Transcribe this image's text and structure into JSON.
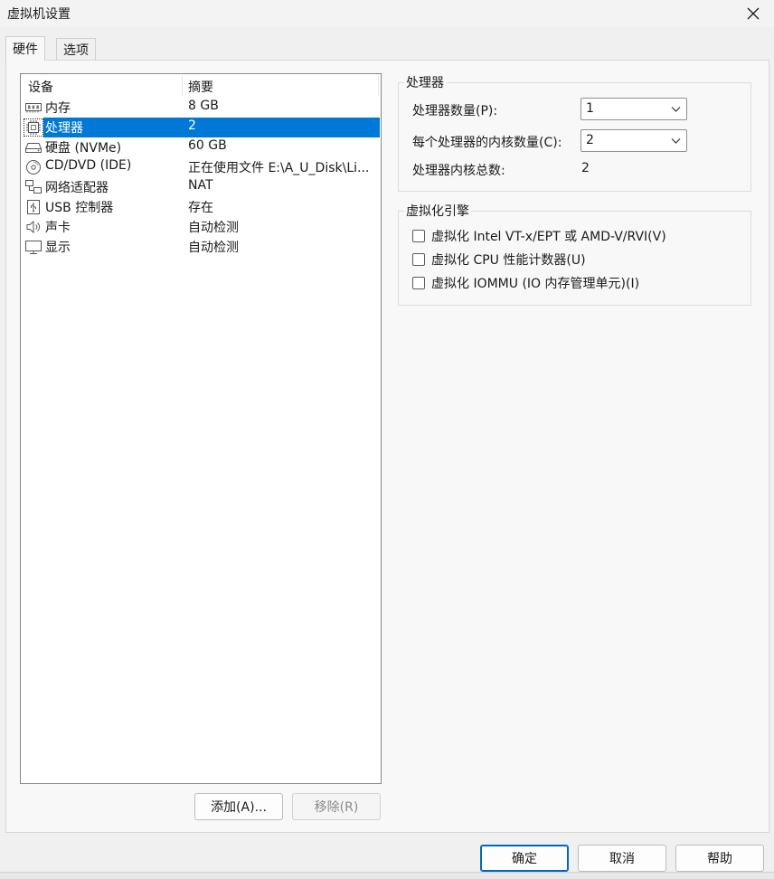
{
  "window": {
    "title": "虚拟机设置"
  },
  "tabs": [
    {
      "label": "硬件",
      "active": true
    },
    {
      "label": "选项",
      "active": false
    }
  ],
  "device_list": {
    "columns": [
      "设备",
      "摘要"
    ],
    "rows": [
      {
        "name": "内存",
        "summary": "8 GB",
        "icon": "memory-icon"
      },
      {
        "name": "处理器",
        "summary": "2",
        "icon": "processor-icon",
        "selected": true
      },
      {
        "name": "硬盘 (NVMe)",
        "summary": "60 GB",
        "icon": "hard-disk-icon"
      },
      {
        "name": "CD/DVD (IDE)",
        "summary": "正在使用文件 E:\\A_U_Disk\\Li...",
        "icon": "cd-dvd-icon"
      },
      {
        "name": "网络适配器",
        "summary": "NAT",
        "icon": "network-adapter-icon"
      },
      {
        "name": "USB 控制器",
        "summary": "存在",
        "icon": "usb-icon"
      },
      {
        "name": "声卡",
        "summary": "自动检测",
        "icon": "speaker-icon"
      },
      {
        "name": "显示",
        "summary": "自动检测",
        "icon": "monitor-icon"
      }
    ],
    "add_label": "添加(A)...",
    "remove_label": "移除(R)"
  },
  "processor": {
    "group_title": "处理器",
    "count_label": "处理器数量(P):",
    "count_value": "1",
    "cores_label": "每个处理器的内核数量(C):",
    "cores_value": "2",
    "total_label": "处理器内核总数:",
    "total_value": "2"
  },
  "virtualization": {
    "group_title": "虚拟化引擎",
    "options": [
      {
        "label": "虚拟化 Intel VT-x/EPT 或 AMD-V/RVI(V)",
        "checked": false
      },
      {
        "label": "虚拟化 CPU 性能计数器(U)",
        "checked": false
      },
      {
        "label": "虚拟化 IOMMU (IO 内存管理单元)(I)",
        "checked": false
      }
    ]
  },
  "footer": {
    "ok_label": "确定",
    "cancel_label": "取消",
    "help_label": "帮助"
  },
  "colors": {
    "selection": "#0078d7",
    "window_bg": "#f0f0f0",
    "panel_bg": "#f8f8f8"
  }
}
